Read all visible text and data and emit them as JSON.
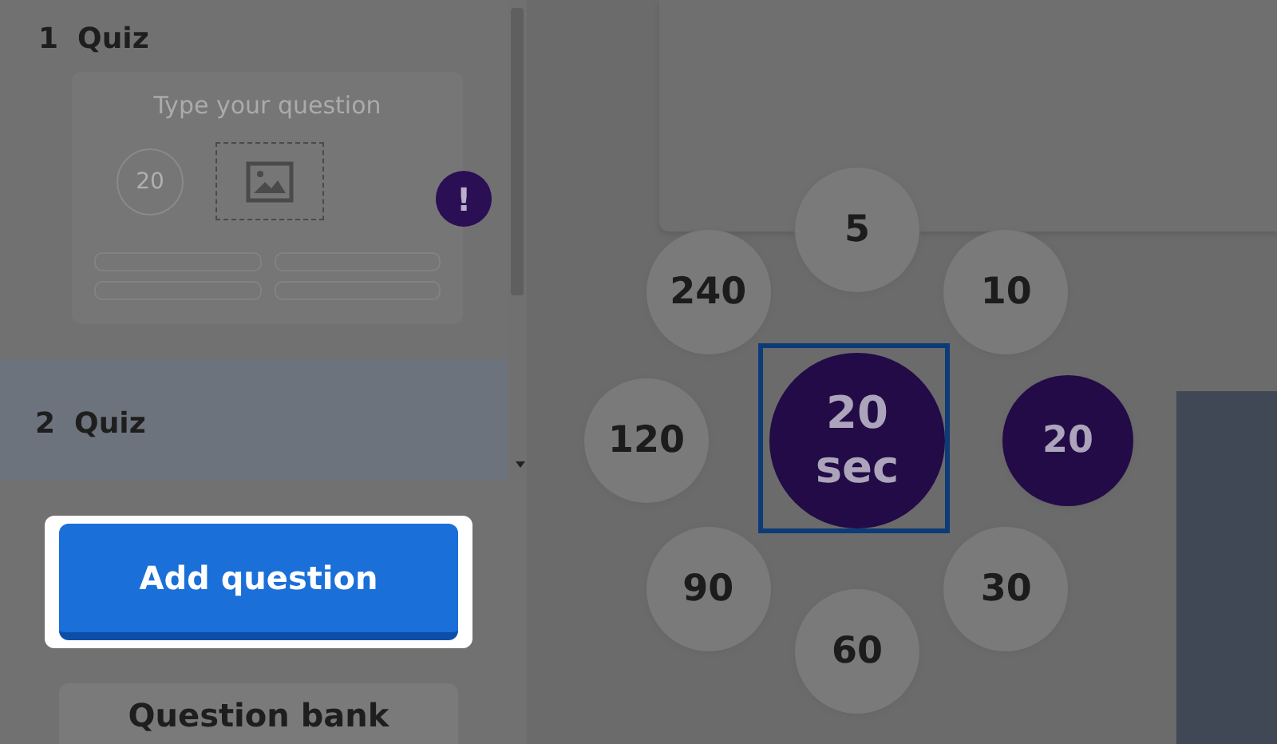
{
  "questions": [
    {
      "number": "1",
      "type": "Quiz",
      "selected": false,
      "placeholder": "Type your question",
      "time": "20",
      "warning": true,
      "warning_mark": "!"
    },
    {
      "number": "2",
      "type": "Quiz",
      "selected": true,
      "warning": false
    }
  ],
  "buttons": [
    {
      "label": "Add question",
      "kind": "primary"
    },
    {
      "label": "Question bank",
      "kind": "secondary"
    }
  ],
  "time_picker": {
    "value": "20",
    "unit": "sec",
    "options": [
      {
        "label": "5",
        "selected": false
      },
      {
        "label": "10",
        "selected": false
      },
      {
        "label": "20",
        "selected": true
      },
      {
        "label": "30",
        "selected": false
      },
      {
        "label": "60",
        "selected": false
      },
      {
        "label": "90",
        "selected": false
      },
      {
        "label": "120",
        "selected": false
      },
      {
        "label": "240",
        "selected": false
      }
    ]
  }
}
